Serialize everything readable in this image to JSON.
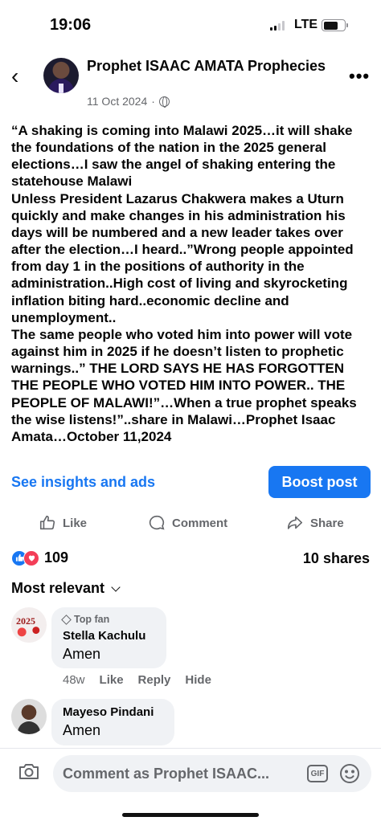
{
  "status_bar": {
    "time": "19:06",
    "network": "LTE",
    "signal_bars_filled": 2,
    "signal_bars_total": 4
  },
  "post": {
    "page_name": "Prophet ISAAC AMATA Prophecies",
    "date": "11 Oct 2024",
    "separator": "·",
    "audience_icon": "globe-icon",
    "more_icon": "more-options-icon",
    "more_glyph": "•••",
    "back_glyph": "‹",
    "text": "“A shaking is coming into Malawi 2025…it will shake the foundations of the nation in the 2025 general elections…I saw the angel of shaking entering the statehouse Malawi\nUnless President Lazarus Chakwera makes a Uturn quickly and make changes in his administration his days will be numbered and a new leader takes over after the election…I heard..”Wrong people appointed from day 1 in the positions of authority in the administration..High cost of living and skyrocketing inflation biting hard..economic decline and unemployment..\nThe same people who voted him into power will vote against him in 2025 if he doesn’t listen to prophetic warnings..” THE LORD SAYS HE HAS FORGOTTEN THE PEOPLE WHO VOTED HIM INTO POWER.. THE PEOPLE OF MALAWI!”…When a true prophet speaks the wise listens!”..share in Malawi…Prophet Isaac Amata…October 11,2024"
  },
  "insights": {
    "link_label": "See insights and ads",
    "boost_label": "Boost post"
  },
  "actions": {
    "like": "Like",
    "comment": "Comment",
    "share": "Share"
  },
  "engagement": {
    "reaction_count": "109",
    "shares": "10 shares",
    "reaction_types": [
      "like",
      "love"
    ]
  },
  "comments_section": {
    "sort_label": "Most relevant",
    "comments": [
      {
        "badge": "Top fan",
        "author": "Stella Kachulu",
        "text": "Amen",
        "avatar_text": "2025",
        "time": "48w",
        "like": "Like",
        "reply": "Reply",
        "hide": "Hide"
      },
      {
        "author": "Mayeso Pindani",
        "text": "Amen"
      }
    ]
  },
  "composer": {
    "placeholder": "Comment as Prophet ISAAC...",
    "gif_label": "GIF"
  },
  "colors": {
    "accent": "#1877f2",
    "secondary_text": "#65676b",
    "bubble": "#f0f2f5",
    "love": "#f33e58"
  }
}
